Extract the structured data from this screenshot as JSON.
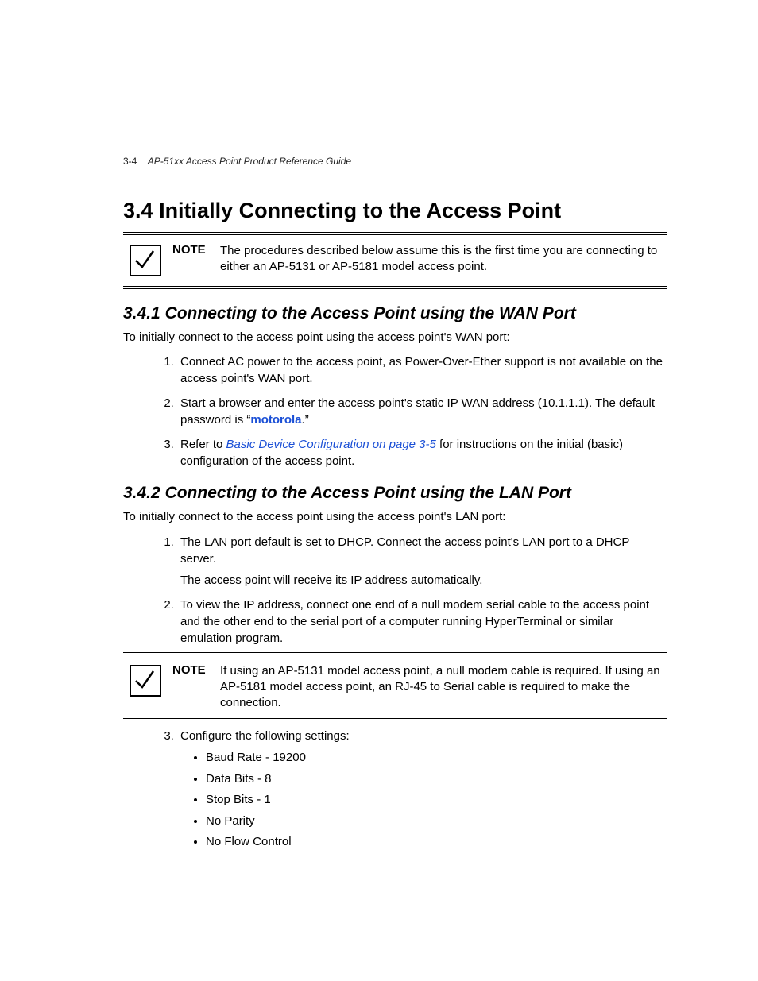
{
  "header": {
    "pageno": "3-4",
    "book_title": "AP-51xx Access Point Product Reference Guide"
  },
  "section": {
    "number": "3.4",
    "title": "Initially Connecting to the Access Point"
  },
  "note1": {
    "label": "NOTE",
    "text": "The procedures described below assume this is the first time you are connecting to either an AP-5131 or AP-5181 model access point."
  },
  "sub1": {
    "number": "3.4.1",
    "title": "Connecting to the Access Point using the WAN Port",
    "intro": "To initially connect to the access point using the access point's WAN port:",
    "steps": {
      "s1": "Connect AC power to the access point, as Power-Over-Ether support is not available on the access point's WAN port.",
      "s2_a": "Start a browser and enter the access point's static IP WAN address (10.1.1.1). The default password is “",
      "s2_kw": "motorola",
      "s2_b": ".”",
      "s3_a": "Refer to ",
      "s3_link": "Basic Device Configuration on page 3-5",
      "s3_b": " for instructions on the initial (basic) configuration of the access point."
    }
  },
  "sub2": {
    "number": "3.4.2",
    "title": "Connecting to the Access Point using the LAN Port",
    "intro": "To initially connect to the access point using the access point's LAN port:",
    "steps": {
      "s1a": "The LAN port default is set to DHCP. Connect the access point's LAN port to a DHCP server.",
      "s1b": "The access point will receive its IP address automatically.",
      "s2": "To view the IP address, connect one end of a null modem serial cable to the access point and the other end to the serial port of a computer running HyperTerminal or similar emulation program.",
      "s3": "Configure the following settings:",
      "bullets": {
        "b1": "Baud Rate - 19200",
        "b2": "Data Bits - 8",
        "b3": "Stop Bits - 1",
        "b4": "No Parity",
        "b5": "No Flow Control"
      }
    }
  },
  "note2": {
    "label": "NOTE",
    "text": "If using an AP-5131 model access point, a null modem cable is required. If using an AP-5181 model access point, an RJ-45 to Serial cable is required to make the connection."
  }
}
